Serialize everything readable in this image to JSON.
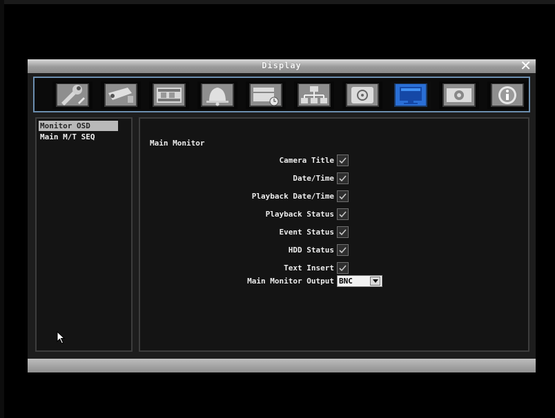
{
  "window": {
    "title": "Display",
    "close_glyph": "✕"
  },
  "toolbar": {
    "buttons": [
      {
        "icon": "tools-icon",
        "active": false
      },
      {
        "icon": "camera-icon",
        "active": false
      },
      {
        "icon": "film-icon",
        "active": false
      },
      {
        "icon": "bell-alarm-icon",
        "active": false
      },
      {
        "icon": "schedule-disk-icon",
        "active": false
      },
      {
        "icon": "network-icon",
        "active": false
      },
      {
        "icon": "backup-disk-icon",
        "active": false
      },
      {
        "icon": "display-monitor-icon",
        "active": true
      },
      {
        "icon": "system-gear-icon",
        "active": false
      },
      {
        "icon": "information-icon",
        "active": false
      }
    ]
  },
  "sidebar": {
    "items": [
      {
        "label": "Monitor OSD",
        "selected": true
      },
      {
        "label": "Main M/T SEQ",
        "selected": false
      }
    ]
  },
  "main": {
    "section_title": "Main Monitor",
    "fields": [
      {
        "label": "Camera Title",
        "checked": true
      },
      {
        "label": "Date/Time",
        "checked": true
      },
      {
        "label": "Playback Date/Time",
        "checked": true
      },
      {
        "label": "Playback Status",
        "checked": true
      },
      {
        "label": "Event Status",
        "checked": true
      },
      {
        "label": "HDD Status",
        "checked": true
      },
      {
        "label": "Text Insert",
        "checked": true
      }
    ],
    "output": {
      "label": "Main Monitor Output",
      "value": "BNC"
    }
  },
  "colors": {
    "toolbar_border": "#6c8fb0",
    "active_icon": "#2a6fd6",
    "selected_item_bg": "#b9b9b9"
  }
}
